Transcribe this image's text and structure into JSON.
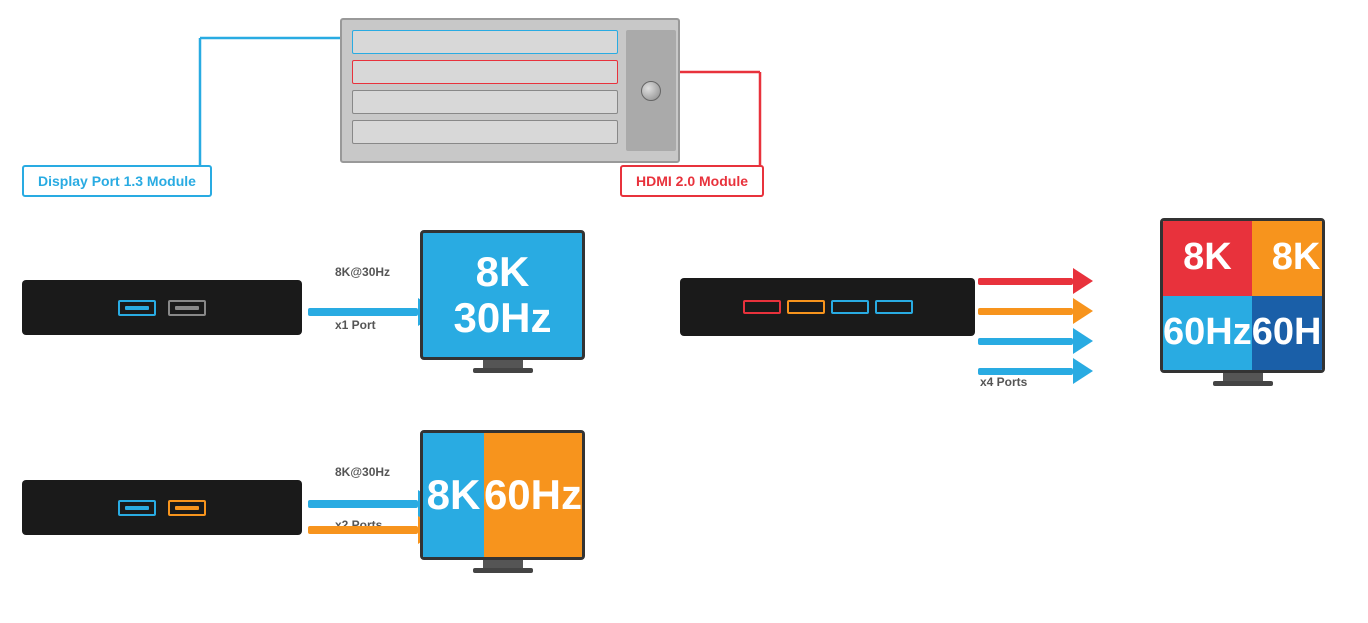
{
  "labels": {
    "display_port_module": "Display Port 1.3 Module",
    "hdmi_module": "HDMI 2.0 Module",
    "freq_top": "8K@30Hz",
    "freq_bottom": "8K@30Hz",
    "ports_x1": "x1 Port",
    "ports_x2": "x2 Ports",
    "ports_x4": "x4 Ports",
    "resolution_8k": "8K",
    "resolution_30hz": "30Hz",
    "resolution_60hz": "60Hz"
  },
  "colors": {
    "blue": "#29abe2",
    "red": "#e8323c",
    "orange": "#f7941d",
    "dark_blue": "#1a5fa8",
    "dark": "#1a1a1a",
    "white": "#ffffff"
  }
}
